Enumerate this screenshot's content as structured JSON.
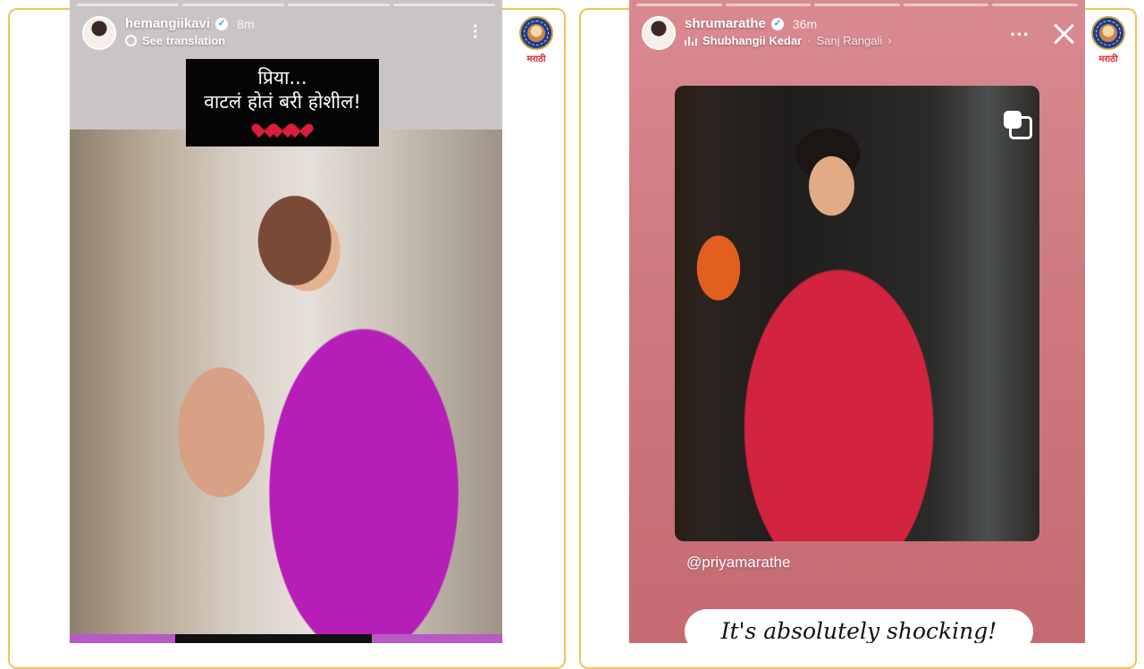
{
  "left_story": {
    "username": "hemangiikavi",
    "time": "8m",
    "subtext": "See translation",
    "caption_line1": "प्रिया...",
    "caption_line2": "वाटलं होतं बरी होशील!",
    "photo_desc": "photo"
  },
  "right_story": {
    "username": "shrumarathe",
    "time": "36m",
    "music_artist": "Shubhangii Kedar",
    "music_separator": "·",
    "music_song": "Sanj Rangali",
    "mention": "@priyamarathe",
    "sticker_text": "It's absolutely shocking!"
  },
  "logo": {
    "caption": "मराठी",
    "seal_text": "RAJSHRI EST. 1947"
  },
  "colors": {
    "frame_border": "#f0c35a",
    "left_bg": "#c9c5c7",
    "right_bg": "#cf7b82",
    "logo_blue": "#1e3b8f",
    "logo_red": "#d8262d"
  }
}
